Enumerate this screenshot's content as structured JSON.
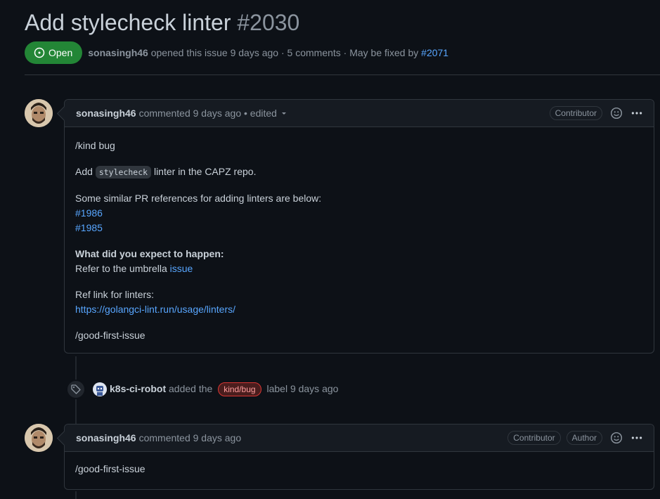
{
  "issue": {
    "title": "Add stylecheck linter",
    "number": "#2030",
    "state": "Open",
    "author": "sonasingh46",
    "opened_text": "opened this issue 9 days ago · 5 comments · May be fixed by",
    "fixed_by": "#2071"
  },
  "comment1": {
    "author": "sonasingh46",
    "meta": "commented 9 days ago • edited",
    "badges": [
      "Contributor"
    ],
    "body": {
      "line1": "/kind bug",
      "add_prefix": "Add",
      "code": "stylecheck",
      "add_suffix": "linter in the CAPZ repo.",
      "similar": "Some similar PR references for adding linters are below:",
      "ref1": "#1986",
      "ref2": "#1985",
      "expect_heading": "What did you expect to happen:",
      "expect_text": "Refer to the umbrella",
      "expect_link": "issue",
      "reflink_label": "Ref link for linters:",
      "reflink_url": "https://golangci-lint.run/usage/linters/",
      "last": "/good-first-issue"
    }
  },
  "event": {
    "actor": "k8s-ci-robot",
    "action": "added the",
    "label": "kind/bug",
    "suffix": "label 9 days ago"
  },
  "comment2": {
    "author": "sonasingh46",
    "meta": "commented 9 days ago",
    "badges": [
      "Contributor",
      "Author"
    ],
    "body": "/good-first-issue"
  },
  "colors": {
    "open_green": "#238636",
    "link_blue": "#58a6ff",
    "label_red": "#da3633"
  }
}
